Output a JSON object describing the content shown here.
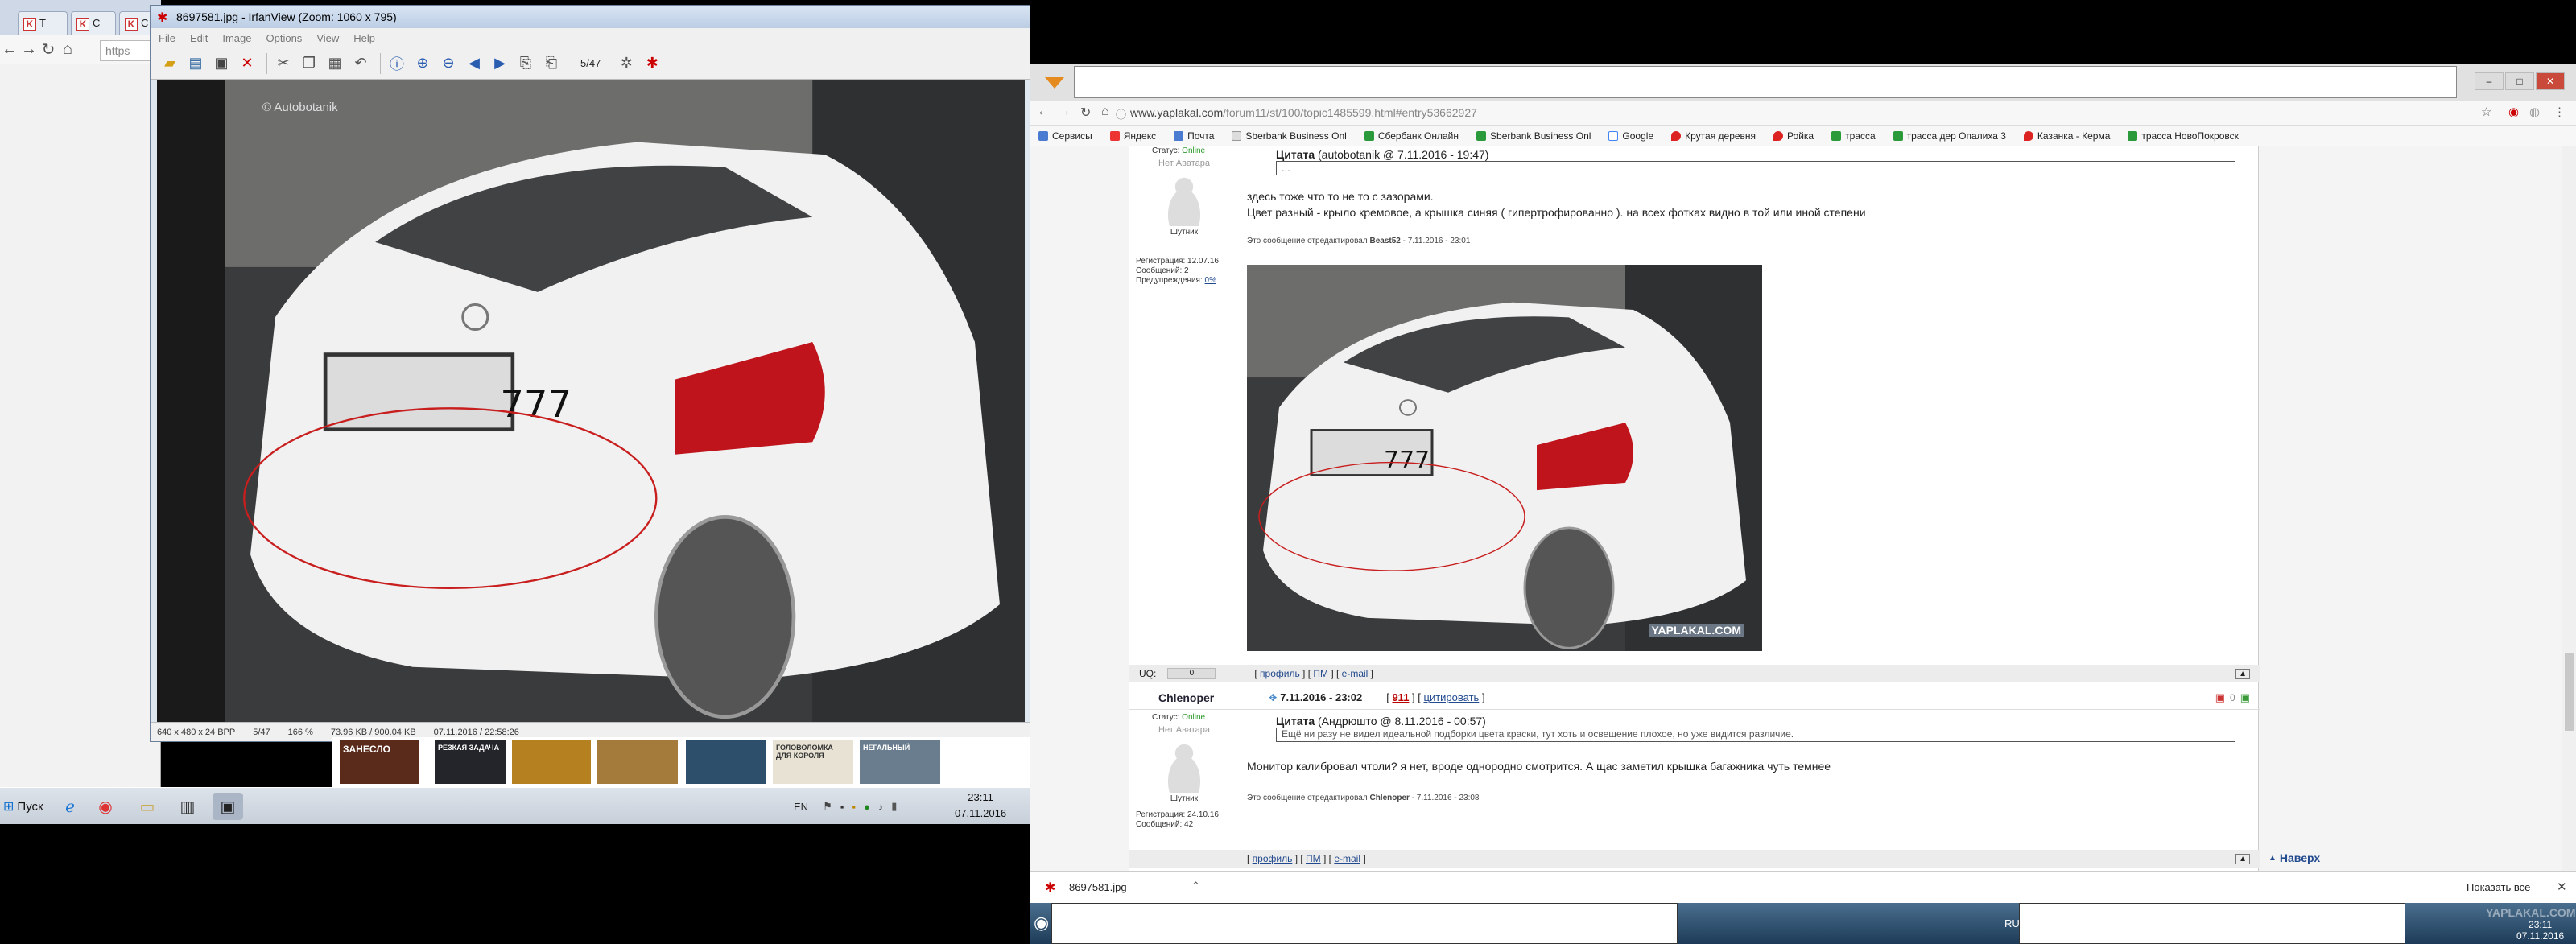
{
  "left": {
    "chrome_tabs": [
      "Т",
      "С",
      "С"
    ],
    "chrome_url": "https",
    "irfan": {
      "title": "8697581.jpg - IrfanView (Zoom: 1060 x 795)",
      "menu": [
        "File",
        "Edit",
        "Image",
        "Options",
        "View",
        "Help"
      ],
      "page_counter": "5/47",
      "watermark": "© Autobotanik",
      "status": [
        "640 x 480 x 24 BPP",
        "5/47",
        "166 %",
        "73.96 KB / 900.04 KB",
        "07.11.2016 / 22:58:26"
      ]
    },
    "thumbs": [
      "ЗАНЕСЛО",
      "РЕЗКАЯ ЗАДАЧА",
      "",
      "",
      "",
      "ГОЛОВОЛОМКА ДЛЯ КОРОЛЯ",
      "НЕГАЛЬНЫЙ"
    ],
    "taskbar": {
      "start": "Пуск",
      "lang": "EN",
      "clock_time": "23:11",
      "clock_date": "07.11.2016"
    }
  },
  "right": {
    "url_host": "www.yaplakal.com",
    "url_path": "/forum11/st/100/topic1485599.html#entry53662927",
    "bookmarks": [
      "Сервисы",
      "Яндекс",
      "Почта",
      "Sberbank Business Onl",
      "Сбербанк Онлайн",
      "Sberbank Business Onl",
      "Google",
      "Крутая деревня",
      "Ройка",
      "трасса",
      "трасса дер Опалиха 3",
      "Казанка - Керма",
      "трасса НовоПокровск"
    ],
    "post1": {
      "status_label": "Статус:",
      "status_value": "Online",
      "avatar_text": "Нет Аватара",
      "rank": "Шутник",
      "reg_label": "Регистрация:",
      "reg_value": "12.07.16",
      "msgs_label": "Сообщений:",
      "msgs_value": "2",
      "warn_label": "Предупреждения:",
      "warn_value": "0%",
      "quote_word": "Цитата",
      "quote_meta": "(autobotanik @ 7.11.2016 - 19:47)",
      "quote_text": "...",
      "text1": "здесь тоже что то не то с зазорами.",
      "text2": "Цвет разный - крыло кремовое, а крышка синяя ( гипертрофированно ). на всех фотках видно в той или иной степени",
      "edit_prefix": "Это сообщение отредактировал",
      "edit_user": "Beast52",
      "edit_time": "- 7.11.2016 - 23:01",
      "image_watermark": "YAPLAKAL.COM",
      "uq_label": "UQ:",
      "uq_value": "0",
      "footer_links": [
        "профиль",
        "ПМ",
        "e-mail"
      ]
    },
    "post2": {
      "author": "Chlenoper",
      "date": "7.11.2016 - 23:02",
      "post_num": "911",
      "quote_action": "цитировать",
      "rating": "0",
      "status_label": "Статус:",
      "status_value": "Online",
      "avatar_text": "Нет Аватара",
      "rank": "Шутник",
      "reg_label": "Регистрация:",
      "reg_value": "24.10.16",
      "msgs_label": "Сообщений:",
      "msgs_value": "42",
      "quote_word": "Цитата",
      "quote_meta": "(Андрюшто @ 8.11.2016 - 00:57)",
      "quote_text": "Ещё ни разу не видел идеальной подборки цвета краски, тут хоть и освещение плохое, но уже видится различие.",
      "text1": "Монитор калибровал чтоли? я нет, вроде однородно смотрится. А щас заметил крышка багажника чуть темнее",
      "edit_prefix": "Это сообщение отредактировал",
      "edit_user": "Chlenoper",
      "edit_time": "- 7.11.2016 - 23:08",
      "footer_links": [
        "профиль",
        "ПМ",
        "e-mail"
      ],
      "to_top": "Наверх"
    },
    "download": {
      "filename": "8697581.jpg",
      "show_all": "Показать все"
    },
    "taskbar": {
      "lang": "RU",
      "clock_time": "23:11",
      "clock_date": "07.11.2016"
    }
  },
  "colors": {
    "online": "#2a9a2a",
    "link_red": "#bb0000",
    "accent_orange": "#e58a1f"
  }
}
